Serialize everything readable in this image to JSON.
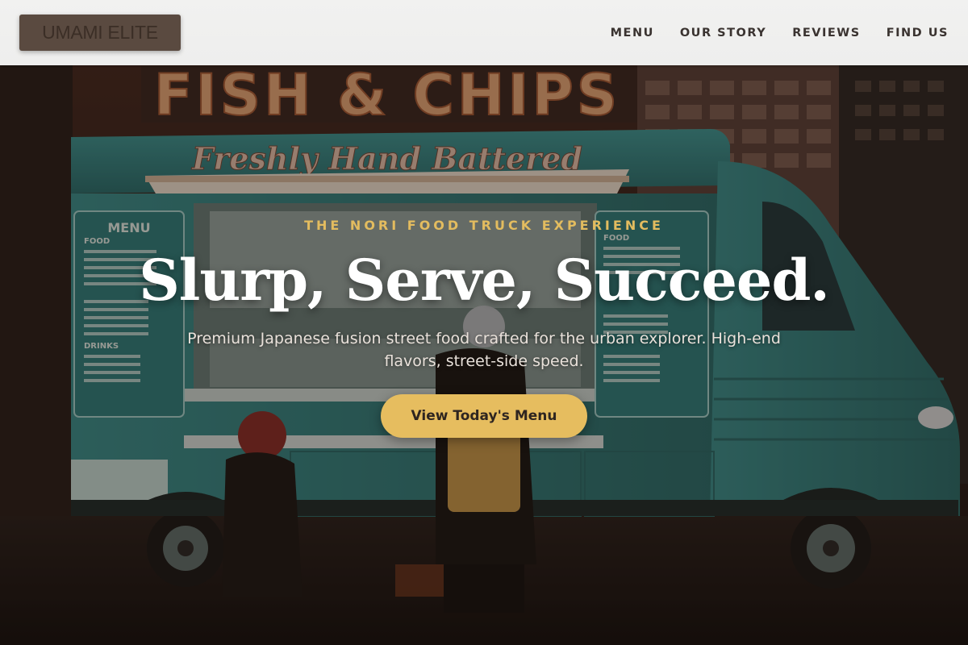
{
  "nav": {
    "logo_text": "UMAMI ELITE",
    "links": [
      {
        "label": "MENU"
      },
      {
        "label": "OUR STORY"
      },
      {
        "label": "REVIEWS"
      },
      {
        "label": "FIND US"
      }
    ]
  },
  "hero": {
    "eyebrow": "THE NORI FOOD TRUCK EXPERIENCE",
    "headline": "Slurp, Serve, Succeed.",
    "subline": "Premium Japanese fusion street food crafted for the urban explorer. High-end flavors, street-side speed.",
    "cta_label": "View Today's Menu"
  },
  "background_photo": {
    "sign_text": "FISH & CHIPS",
    "truck_script": "Freshly Hand Battered",
    "menu_board_title": "MENU",
    "menu_board_sections": [
      "FOOD",
      "DRINKS"
    ]
  },
  "colors": {
    "accent_gold": "#e6bd5f",
    "logo_bg": "#5a4a40",
    "truck_teal": "#3d8c8a"
  }
}
